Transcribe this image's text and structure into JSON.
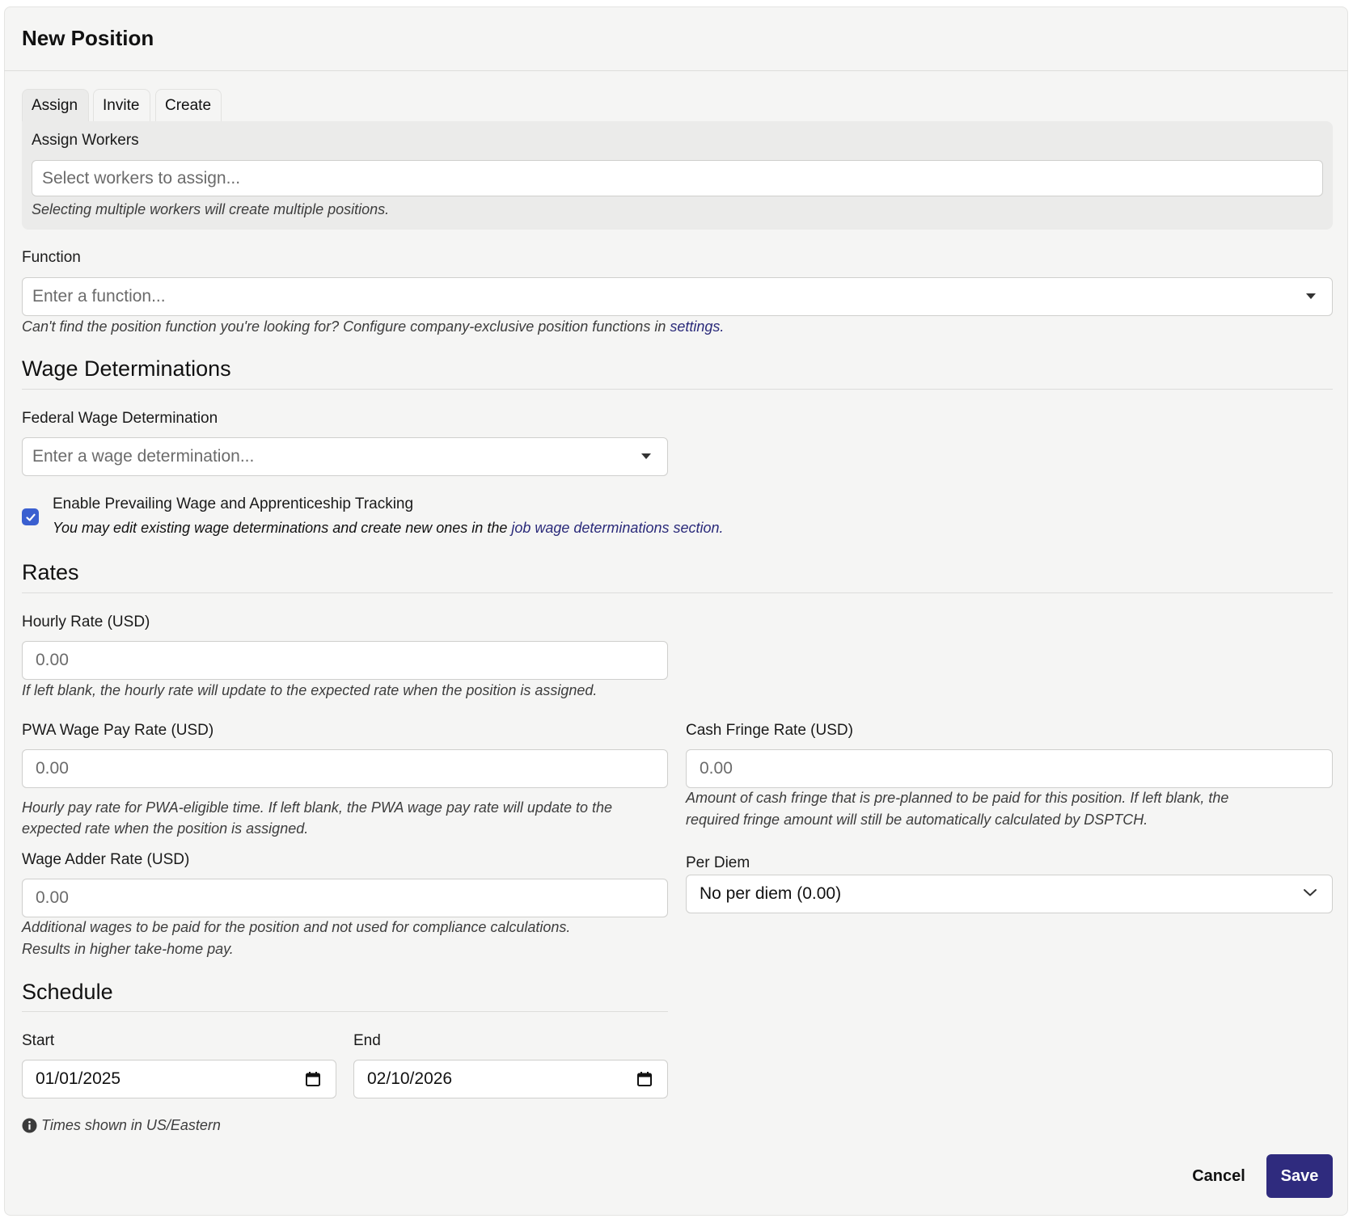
{
  "modal": {
    "title": "New Position"
  },
  "tabs": [
    {
      "label": "Assign"
    },
    {
      "label": "Invite"
    },
    {
      "label": "Create"
    }
  ],
  "assign": {
    "label": "Assign Workers",
    "placeholder": "Select workers to assign...",
    "hint": "Selecting multiple workers will create multiple positions."
  },
  "function": {
    "label": "Function",
    "placeholder": "Enter a function...",
    "hint_prefix": "Can't find the position function you're looking for? Configure company-exclusive position functions in ",
    "hint_link": "settings."
  },
  "wage_determinations": {
    "heading": "Wage Determinations",
    "federal_label": "Federal Wage Determination",
    "federal_placeholder": "Enter a wage determination...",
    "checkbox_label": "Enable Prevailing Wage and Apprenticeship Tracking",
    "checkbox_checked": true,
    "checkbox_hint_prefix": "You may edit existing wage determinations and create new ones in the ",
    "checkbox_hint_link": "job wage determinations section."
  },
  "rates": {
    "heading": "Rates",
    "hourly": {
      "label": "Hourly Rate (USD)",
      "placeholder": "0.00",
      "hint": "If left blank, the hourly rate will update to the expected rate when the position is assigned."
    },
    "pwa": {
      "label": "PWA Wage Pay Rate (USD)",
      "placeholder": "0.00",
      "hint_line1": "Hourly pay rate for PWA-eligible time. If left blank, the PWA wage pay rate will update to the",
      "hint_line2": "expected rate when the position is assigned."
    },
    "cash_fringe": {
      "label": "Cash Fringe Rate (USD)",
      "placeholder": "0.00",
      "hint_line1": "Amount of cash fringe that is pre-planned to be paid for this position. If left blank, the",
      "hint_line2": "required fringe amount will still be automatically calculated by DSPTCH."
    },
    "wage_adder": {
      "label": "Wage Adder Rate (USD)",
      "placeholder": "0.00",
      "hint_line1": "Additional wages to be paid for the position and not used for compliance calculations.",
      "hint_line2": "Results in higher take-home pay."
    },
    "per_diem": {
      "label": "Per Diem",
      "value": "No per diem (0.00)"
    }
  },
  "schedule": {
    "heading": "Schedule",
    "start_label": "Start",
    "start_value": "01/01/2025",
    "end_label": "End",
    "end_value": "02/10/2026",
    "timezone_note": "Times shown in US/Eastern"
  },
  "actions": {
    "cancel": "Cancel",
    "save": "Save"
  },
  "colors": {
    "primary": "#2f2b7e",
    "checkbox": "#3a5fd0",
    "link": "#2a2a7a"
  }
}
